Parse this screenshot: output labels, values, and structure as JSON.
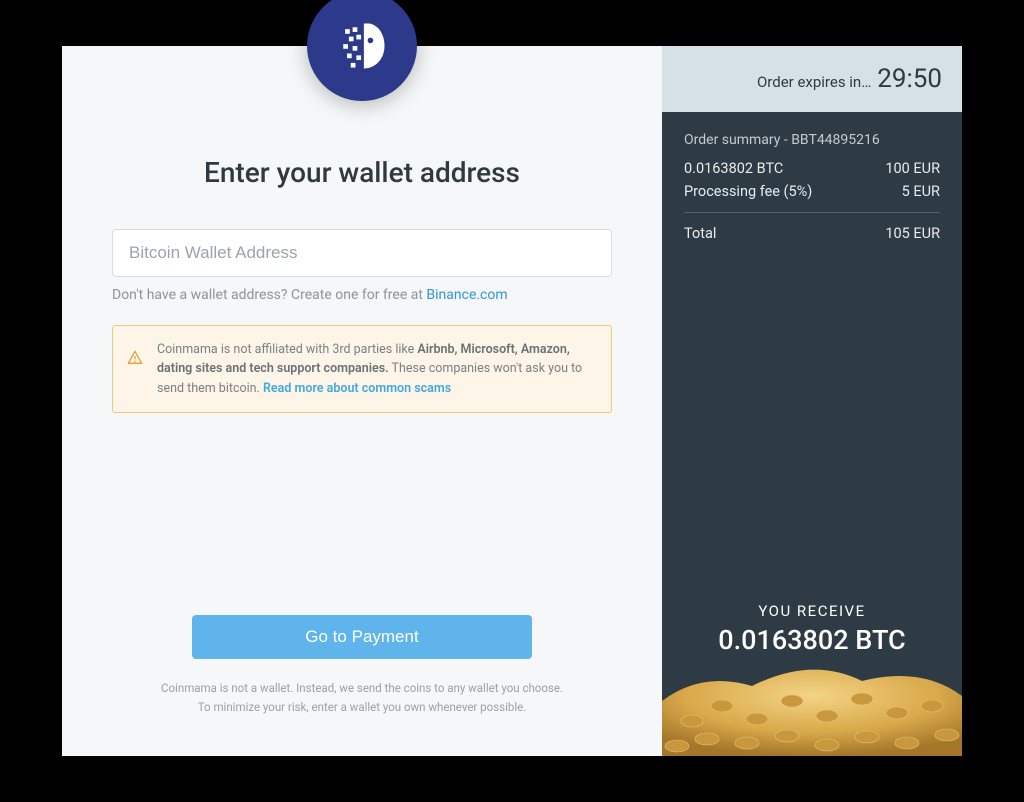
{
  "left": {
    "title": "Enter your wallet address",
    "input_placeholder": "Bitcoin Wallet Address",
    "helper_prefix": "Don't have a wallet address? Create one for free at ",
    "helper_link_text": "Binance.com",
    "warning_pre": "Coinmama is not affiliated with 3rd parties like ",
    "warning_bold": "Airbnb, Microsoft, Amazon, dating sites and tech support companies.",
    "warning_post": " These companies won't ask you to send them bitcoin. ",
    "warning_link": "Read more about common scams",
    "pay_button": "Go to Payment",
    "footnote_line1": "Coinmama is not a wallet. Instead, we send the coins to any wallet you choose.",
    "footnote_line2": "To minimize your risk, enter a wallet you own whenever possible."
  },
  "right": {
    "expires_label": "Order expires in…",
    "expires_time": "29:50",
    "summary_title": "Order summary - BBT44895216",
    "row1_left": "0.0163802 BTC",
    "row1_right": "100 EUR",
    "row2_left": "Processing fee (5%)",
    "row2_right": "5 EUR",
    "total_left": "Total",
    "total_right": "105 EUR",
    "receive_label": "YOU RECEIVE",
    "receive_amount": "0.0163802 BTC"
  }
}
